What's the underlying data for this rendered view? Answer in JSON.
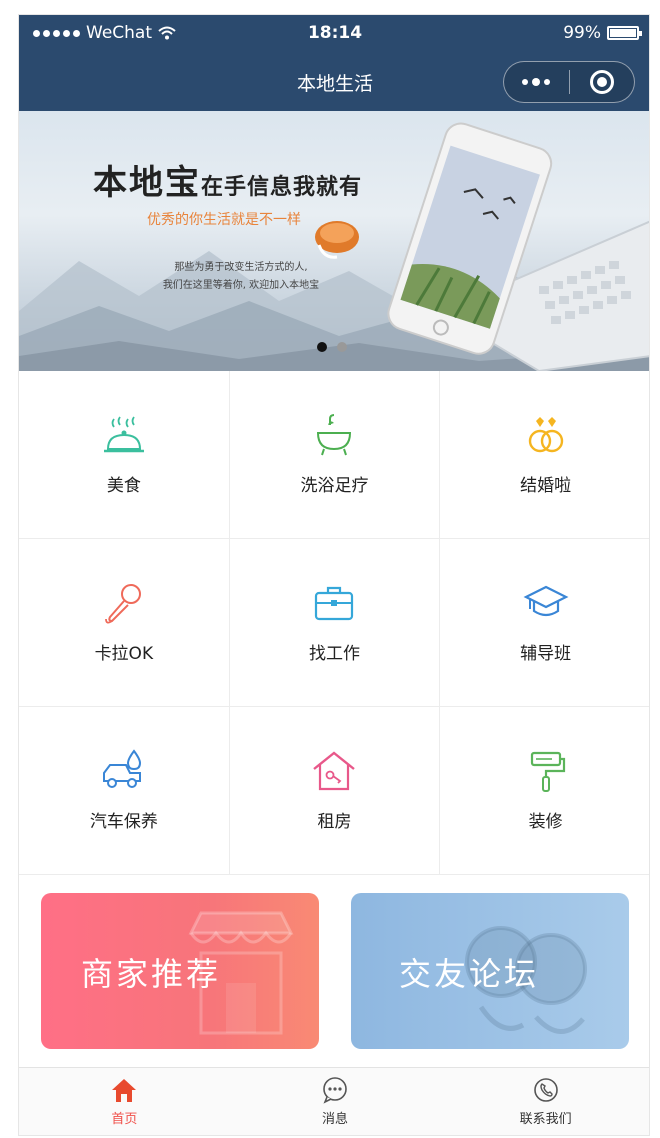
{
  "status": {
    "carrier": "WeChat",
    "time": "18:14",
    "battery": "99%",
    "battery_level": 0.99
  },
  "nav": {
    "title": "本地生活"
  },
  "banner": {
    "headline": "本地宝",
    "headline_tail": "在手信息我就有",
    "subtitle": "优秀的你生活就是不一样",
    "desc_line1": "那些为勇于改变生活方式的人,",
    "desc_line2": "我们在这里等着你, 欢迎加入本地宝",
    "slide_count": 2,
    "active_slide": 1
  },
  "categories": [
    {
      "label": "美食",
      "icon": "food-cloche-icon",
      "color": "#3bbf9e"
    },
    {
      "label": "洗浴足疗",
      "icon": "bathtub-icon",
      "color": "#4caf50"
    },
    {
      "label": "结婚啦",
      "icon": "wedding-rings-icon",
      "color": "#f5b520"
    },
    {
      "label": "卡拉OK",
      "icon": "microphone-icon",
      "color": "#ef6a5a"
    },
    {
      "label": "找工作",
      "icon": "briefcase-icon",
      "color": "#35a7d9"
    },
    {
      "label": "辅导班",
      "icon": "graduation-cap-icon",
      "color": "#3a86d6"
    },
    {
      "label": "汽车保养",
      "icon": "car-wash-icon",
      "color": "#3a86d6"
    },
    {
      "label": "租房",
      "icon": "house-icon",
      "color": "#e8588a"
    },
    {
      "label": "装修",
      "icon": "paint-roller-icon",
      "color": "#5bb45a"
    }
  ],
  "promos": [
    {
      "label": "商家推荐",
      "icon": "storefront-icon"
    },
    {
      "label": "交友论坛",
      "icon": "chat-bubbles-icon"
    }
  ],
  "tabs": [
    {
      "label": "首页",
      "icon": "home-icon",
      "active": true
    },
    {
      "label": "消息",
      "icon": "message-icon",
      "active": false
    },
    {
      "label": "联系我们",
      "icon": "phone-icon",
      "active": false
    }
  ],
  "colors": {
    "navbar": "#2b4a6e",
    "tab_active": "#f0504a",
    "tab_active_icon": "#e84a2e"
  }
}
